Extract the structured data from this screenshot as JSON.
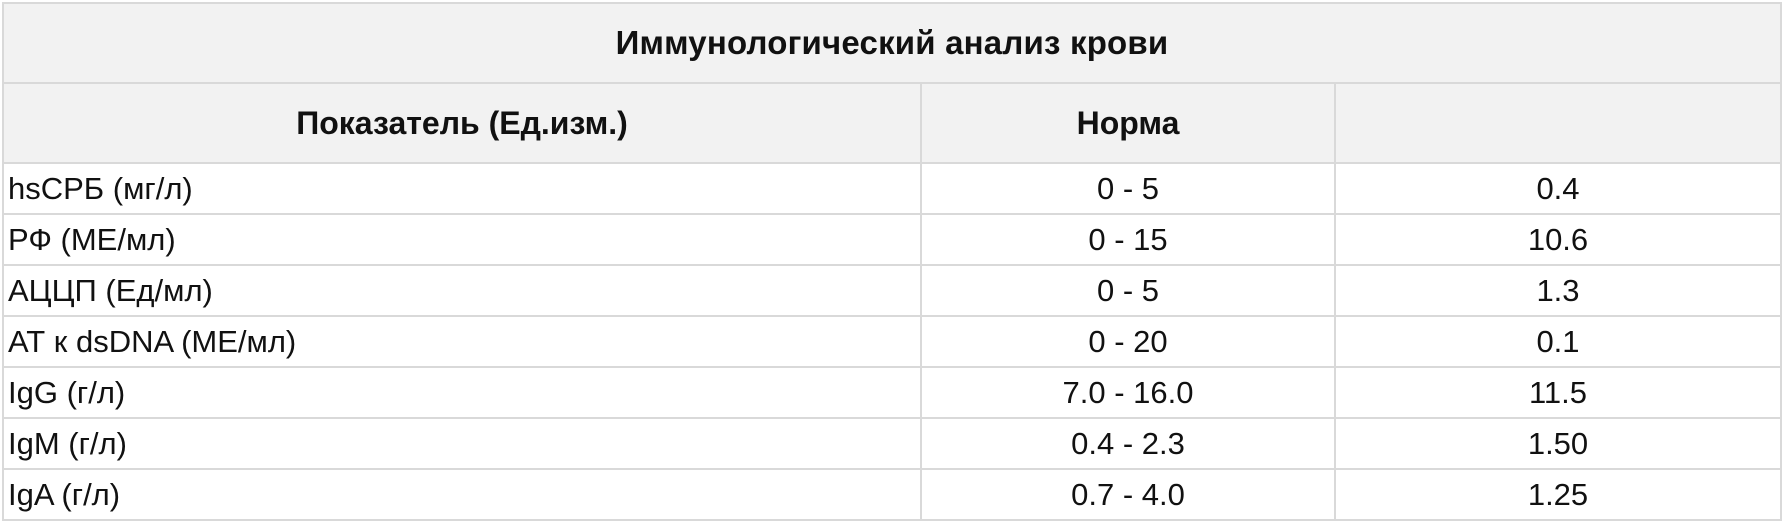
{
  "table": {
    "title": "Иммунологический анализ крови",
    "headers": [
      "Показатель (Ед.изм.)",
      "Норма",
      ""
    ],
    "rows": [
      {
        "name": "hsСРБ (мг/л)",
        "norm": "0 - 5",
        "value": "0.4"
      },
      {
        "name": "РФ (МЕ/мл)",
        "norm": "0 - 15",
        "value": "10.6"
      },
      {
        "name": "АЦЦП (Ед/мл)",
        "norm": "0 - 5",
        "value": "1.3"
      },
      {
        "name": "АТ к dsDNA (МЕ/мл)",
        "norm": "0 - 20",
        "value": "0.1"
      },
      {
        "name": "IgG (г/л)",
        "norm": "7.0 - 16.0",
        "value": "11.5"
      },
      {
        "name": "IgM (г/л)",
        "norm": "0.4 - 2.3",
        "value": "1.50"
      },
      {
        "name": "IgA (г/л)",
        "norm": "0.7 - 4.0",
        "value": "1.25"
      }
    ]
  },
  "colors": {
    "border": "#d9d9d9",
    "header_bg": "#f2f2f2",
    "text": "#111111"
  }
}
